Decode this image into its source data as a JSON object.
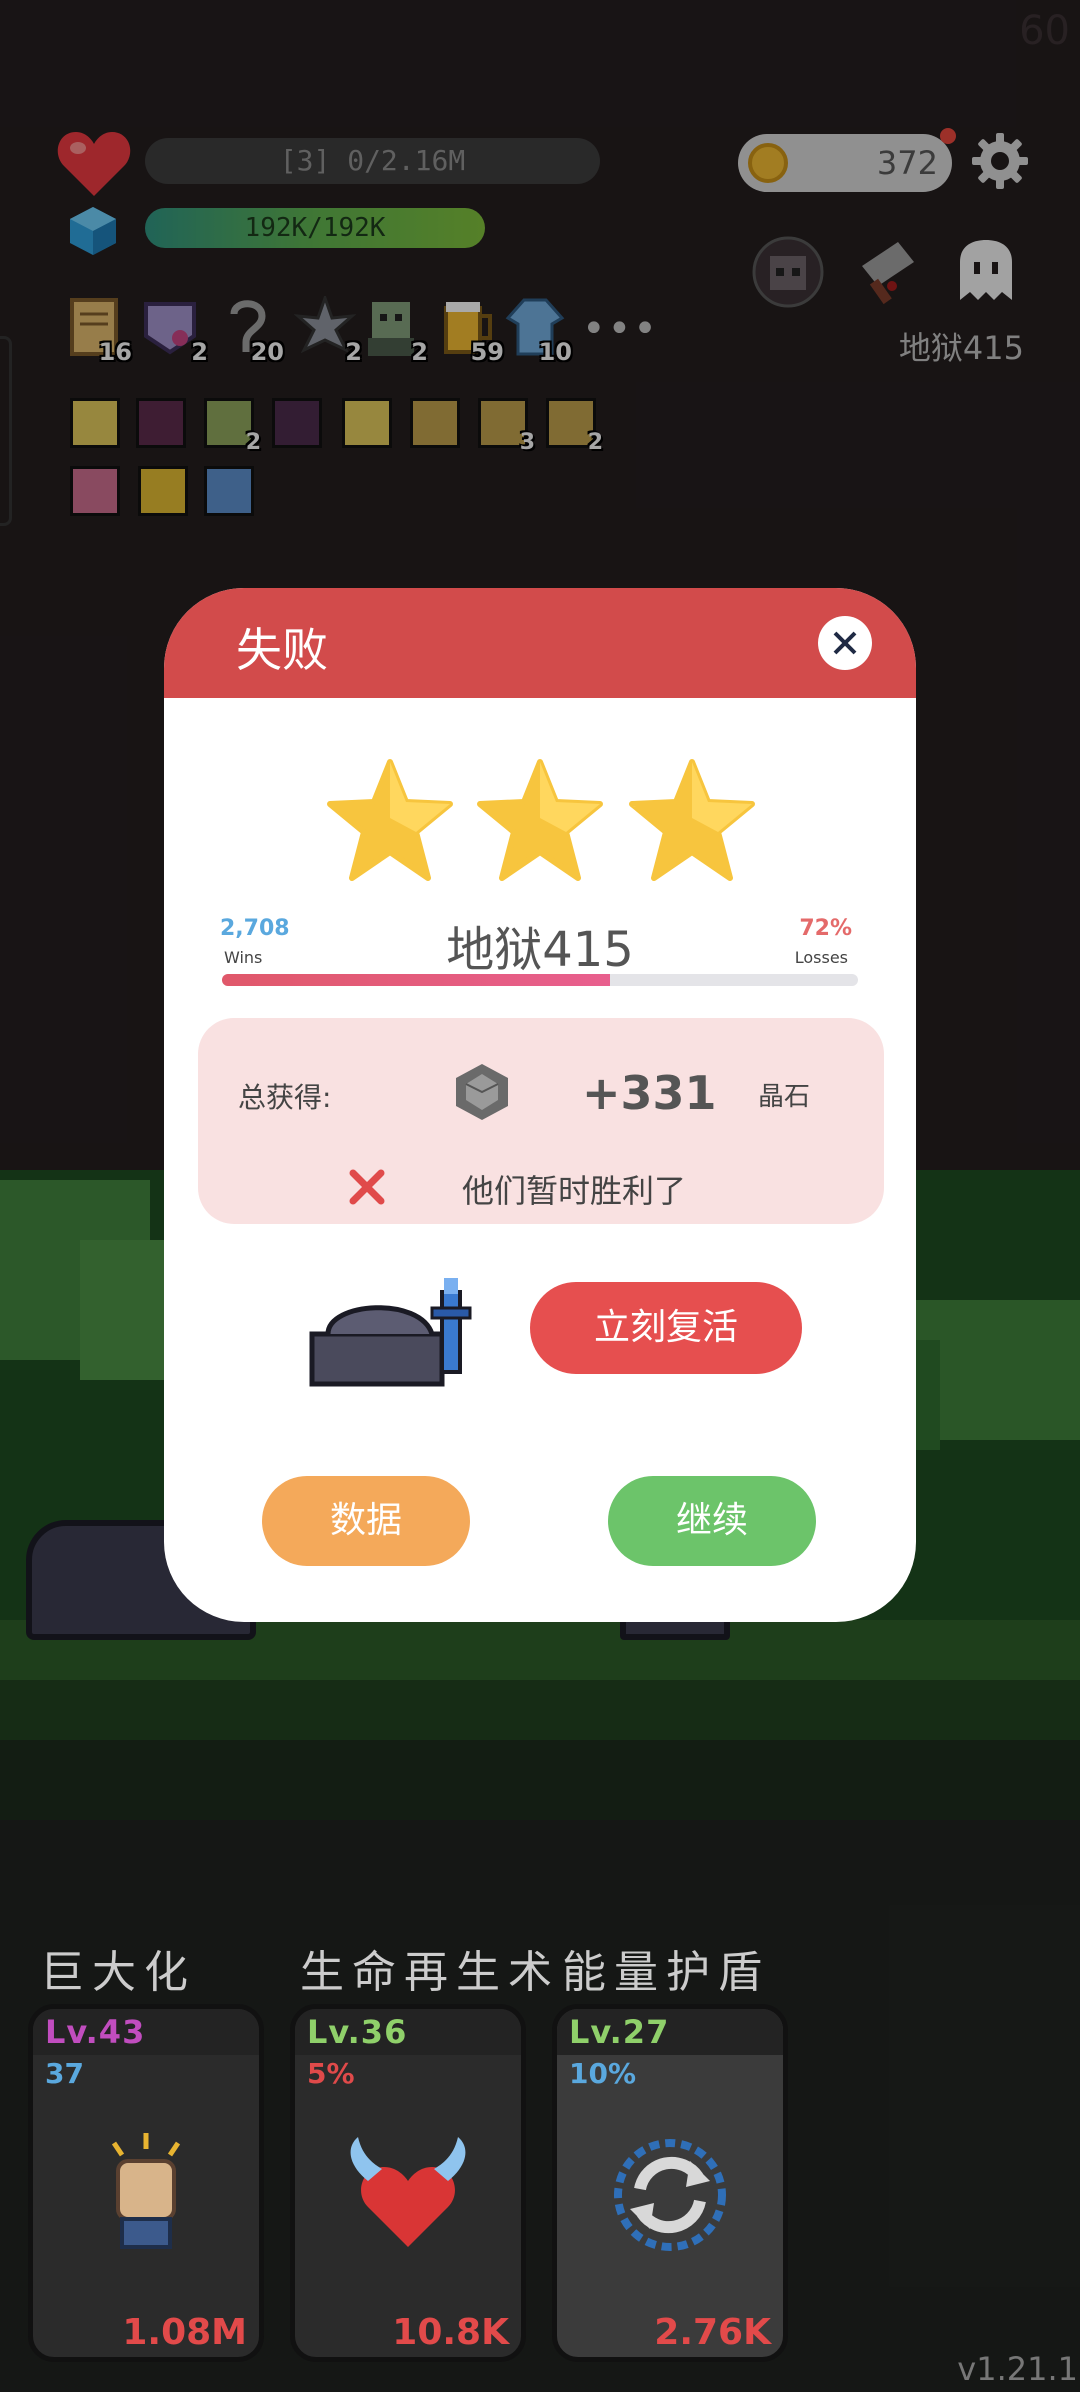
{
  "fps": "60",
  "hud": {
    "hp_text": "[3] 0/2.16M",
    "shield_text": "192K/192K",
    "coins": "372",
    "stage": "地狱415"
  },
  "items": [
    {
      "icon": "scroll-icon",
      "count": "16"
    },
    {
      "icon": "magic-note-icon",
      "count": "2"
    },
    {
      "icon": "hook-icon",
      "count": "20"
    },
    {
      "icon": "spiked-ball-icon",
      "count": "2"
    },
    {
      "icon": "zombie-icon",
      "count": "2"
    },
    {
      "icon": "beer-mug-icon",
      "count": "59"
    },
    {
      "icon": "robe-icon",
      "count": "10"
    }
  ],
  "more_items": "•••",
  "buffs": [
    {
      "icon": "light-buff-icon",
      "count": ""
    },
    {
      "icon": "demon-buff-icon",
      "count": ""
    },
    {
      "icon": "leaf-buff-icon",
      "count": "2"
    },
    {
      "icon": "demon-buff-icon",
      "count": ""
    },
    {
      "icon": "light-buff-icon",
      "count": ""
    },
    {
      "icon": "armor-buff-icon",
      "count": ""
    },
    {
      "icon": "armor-buff-icon",
      "count": "3"
    },
    {
      "icon": "armor-buff-icon",
      "count": "2"
    },
    {
      "icon": "sword-buff-icon",
      "count": ""
    },
    {
      "icon": "shadow-buff-icon",
      "count": ""
    },
    {
      "icon": "frost-buff-icon",
      "count": ""
    }
  ],
  "modal": {
    "title": "失败",
    "stage_name": "地狱415",
    "wins_value": "2,708",
    "wins_label": "Wins",
    "losses_value": "72%",
    "losses_label": "Losses",
    "win_rate": 0.61,
    "reward_label": "总获得:",
    "reward_value": "+331",
    "reward_unit": "晶石",
    "fail_message": "他们暂时胜利了",
    "revive_label": "立刻复活",
    "stats_label": "数据",
    "continue_label": "继续"
  },
  "skills": [
    {
      "title": "巨大化",
      "level": "Lv.43",
      "stat": "37",
      "cost": "1.08M",
      "level_color": "#c14dbf",
      "stat_color": "#5aa8de",
      "icon": "fist-icon"
    },
    {
      "title": "生命再生术",
      "level": "Lv.36",
      "stat": "5%",
      "cost": "10.8K",
      "level_color": "#8fd06a",
      "stat_color": "#e04a4a",
      "icon": "winged-heart-icon"
    },
    {
      "title": "能量护盾",
      "level": "Lv.27",
      "stat": "10%",
      "cost": "2.76K",
      "level_color": "#8fd06a",
      "stat_color": "#5aa8de",
      "icon": "shield-cycle-icon"
    }
  ],
  "version": "v1.21.1"
}
